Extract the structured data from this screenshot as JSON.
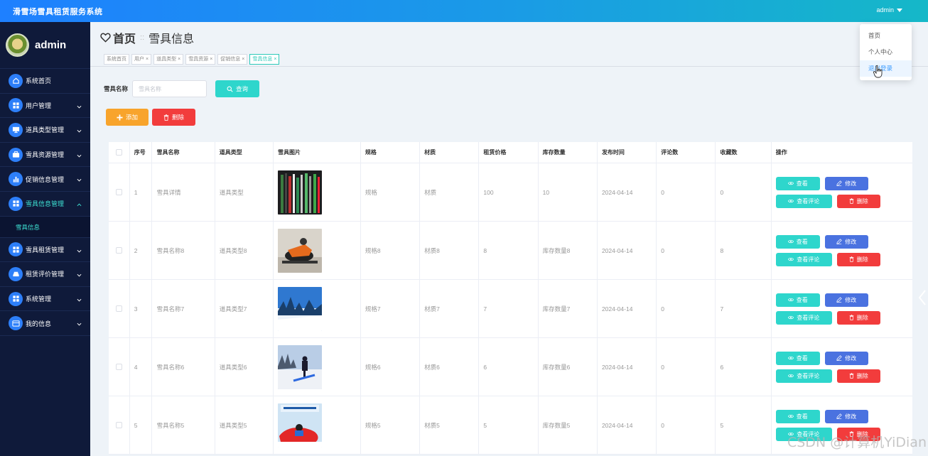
{
  "app": {
    "title": "滑雪场雪具租赁服务系统",
    "user": "admin"
  },
  "dropdown": {
    "items": [
      "首页",
      "个人中心",
      "退出登录"
    ]
  },
  "sidebar": {
    "profile_name": "admin",
    "items": [
      {
        "label": "系统首页",
        "icon": "home-icon"
      },
      {
        "label": "用户管理",
        "icon": "grid-icon"
      },
      {
        "label": "道具类型管理",
        "icon": "monitor-icon"
      },
      {
        "label": "雪具资源管理",
        "icon": "briefcase-icon"
      },
      {
        "label": "促销信息管理",
        "icon": "bar-chart-icon"
      },
      {
        "label": "雪具信息管理",
        "icon": "grid-icon"
      },
      {
        "label": "雪具租赁管理",
        "icon": "grid-icon"
      },
      {
        "label": "租赁评价管理",
        "icon": "car-icon"
      },
      {
        "label": "系统管理",
        "icon": "grid-icon"
      },
      {
        "label": "我的信息",
        "icon": "id-card-icon"
      }
    ],
    "submenu_label": "雪具信息"
  },
  "breadcrumb": {
    "home": "首页",
    "current": "雪具信息"
  },
  "tabs": [
    "系统首页",
    "用户",
    "道具类型",
    "雪具资源",
    "促销信息",
    "雪具信息"
  ],
  "search": {
    "label": "雪具名称",
    "placeholder": "雪具名称",
    "button": "查询"
  },
  "actions": {
    "add": "添加",
    "delete": "删除"
  },
  "table": {
    "headers": [
      "序号",
      "雪具名称",
      "道具类型",
      "雪具图片",
      "规格",
      "材质",
      "租赁价格",
      "库存数量",
      "发布时间",
      "评论数",
      "收藏数",
      "操作"
    ],
    "rows": [
      {
        "no": "1",
        "name": "雪具详情",
        "type": "道具类型",
        "spec": "规格",
        "material": "材质",
        "price": "100",
        "stock": "10",
        "date": "2024-04-14",
        "comments": "0",
        "favorites": "0"
      },
      {
        "no": "2",
        "name": "雪具名称8",
        "type": "道具类型8",
        "spec": "规格8",
        "material": "材质8",
        "price": "8",
        "stock": "库存数量8",
        "date": "2024-04-14",
        "comments": "0",
        "favorites": "8"
      },
      {
        "no": "3",
        "name": "雪具名称7",
        "type": "道具类型7",
        "spec": "规格7",
        "material": "材质7",
        "price": "7",
        "stock": "库存数量7",
        "date": "2024-04-14",
        "comments": "0",
        "favorites": "7"
      },
      {
        "no": "4",
        "name": "雪具名称6",
        "type": "道具类型6",
        "spec": "规格6",
        "material": "材质6",
        "price": "6",
        "stock": "库存数量6",
        "date": "2024-04-14",
        "comments": "0",
        "favorites": "6"
      },
      {
        "no": "5",
        "name": "雪具名称5",
        "type": "道具类型5",
        "spec": "规格5",
        "material": "材质5",
        "price": "5",
        "stock": "库存数量5",
        "date": "2024-04-14",
        "comments": "0",
        "favorites": "5"
      }
    ],
    "row_buttons": {
      "view": "查看",
      "edit": "修改",
      "comment": "查看评论",
      "delete": "删除"
    }
  },
  "watermark": "CSDN @计算机YiDian",
  "colors": {
    "topbar_start": "#1e80ff",
    "topbar_end": "#15b8c8",
    "sidebar_bg": "#0f1a3a",
    "accent_teal": "#2ed6cc",
    "warning": "#f8a42c",
    "danger": "#f23c3c",
    "primary": "#4a72e0"
  }
}
